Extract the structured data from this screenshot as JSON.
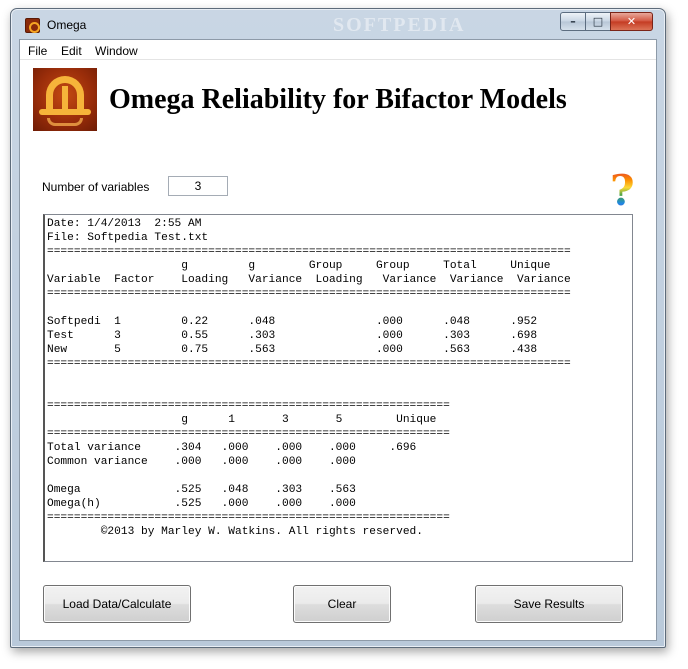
{
  "window": {
    "title": "Omega",
    "watermark": "SOFTPEDIA",
    "controls": {
      "minimize": "–",
      "maximize": "□",
      "close": "✕"
    }
  },
  "menu": [
    "File",
    "Edit",
    "Window"
  ],
  "header": {
    "logo_icon": "omega-logo-icon",
    "title": "Omega Reliability for Bifactor Models"
  },
  "variables": {
    "label": "Number of variables",
    "value": "3"
  },
  "help_icon": "question-mark-icon",
  "output": {
    "lines": [
      "Date: 1/4/2013  2:55 AM",
      "File: Softpedia Test.txt",
      "==============================================================================",
      "                    g         g        Group     Group     Total     Unique",
      "Variable  Factor    Loading   Variance  Loading   Variance  Variance  Variance",
      "==============================================================================",
      "",
      "Softpedi  1         0.22      .048               .000      .048      .952",
      "Test      3         0.55      .303               .000      .303      .698",
      "New       5         0.75      .563               .000      .563      .438",
      "==============================================================================",
      "",
      "",
      "============================================================",
      "                    g      1       3       5        Unique",
      "============================================================",
      "Total variance     .304   .000    .000    .000     .696",
      "Common variance    .000   .000    .000    .000",
      "",
      "Omega              .525   .048    .303    .563",
      "Omega(h)           .525   .000    .000    .000",
      "============================================================",
      "        ©2013 by Marley W. Watkins. All rights reserved."
    ]
  },
  "buttons": {
    "load": "Load Data/Calculate",
    "clear": "Clear",
    "save": "Save Results"
  }
}
